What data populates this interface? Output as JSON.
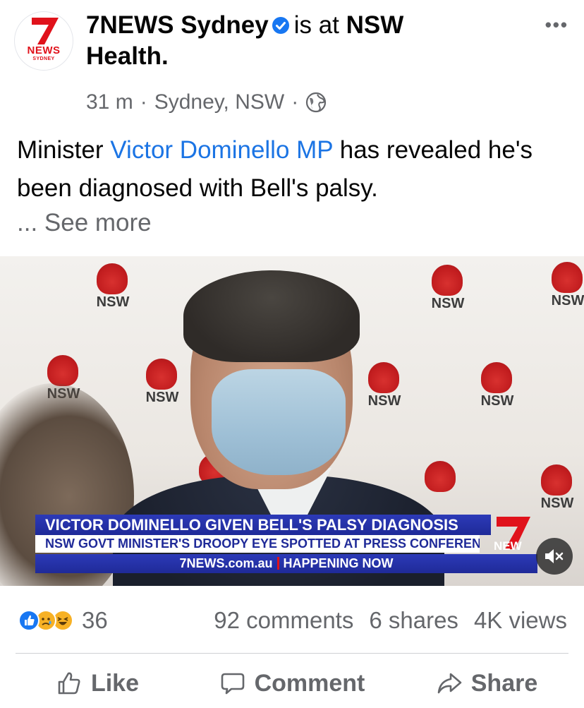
{
  "post": {
    "page_name": "7NEWS Sydney",
    "is_at_text": "is at",
    "location_name": "NSW Health.",
    "time": "31 m",
    "separator": "·",
    "place": "Sydney, NSW",
    "text_before": "Minister ",
    "mention": "Victor Dominello MP",
    "text_after": " has revealed he's been diagnosed with Bell's palsy.",
    "see_more": "... See more",
    "avatar": {
      "logo_number": "7",
      "logo_word": "NEWS",
      "logo_city": "SYDNEY"
    }
  },
  "video": {
    "headline": "VICTOR DOMINELLO GIVEN BELL'S PALSY DIAGNOSIS",
    "subheadline": "NSW GOVT MINISTER'S DROOPY EYE SPOTTED AT PRESS CONFERENCE",
    "ticker_site": "7NEWS.com.au",
    "ticker_status": "HAPPENING NOW",
    "channel_partial": "NEW",
    "backdrop_logo": "NSW",
    "mute_icon": "muted-speaker-icon"
  },
  "engagement": {
    "reaction_count": "36",
    "comments": "92 comments",
    "shares": "6 shares",
    "views": "4K views",
    "reaction_icons": [
      "like-icon",
      "sad-icon",
      "haha-icon"
    ]
  },
  "actions": {
    "like": "Like",
    "comment": "Comment",
    "share": "Share"
  },
  "colors": {
    "link": "#1b74e4",
    "secondary_text": "#65676b",
    "brand_red": "#e0121b",
    "ticker_blue": "#1f2a98"
  }
}
